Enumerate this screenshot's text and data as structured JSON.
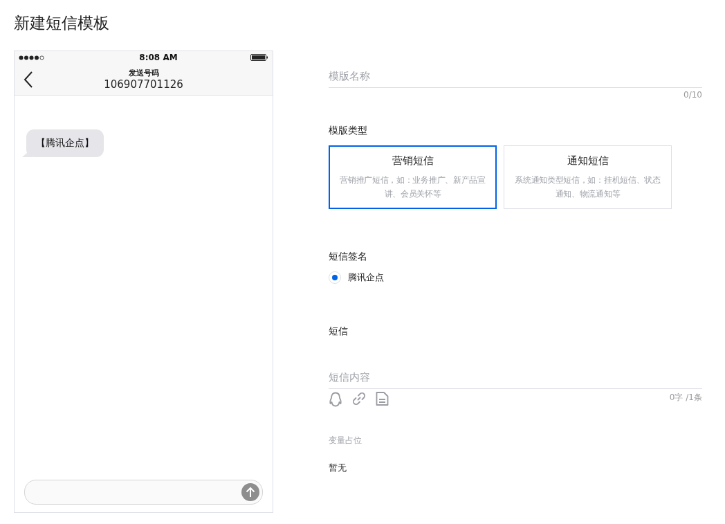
{
  "page_title": "新建短信模板",
  "phone": {
    "time": "8:08 AM",
    "header_label": "发送号码",
    "sender_number": "106907701126",
    "message": "【腾讯企点】"
  },
  "form": {
    "name_field": {
      "placeholder": "模版名称",
      "counter": "0/10"
    },
    "type_label": "模版类型",
    "types": [
      {
        "title": "营销短信",
        "description": "营销推广短信，如：业务推广、新产品宣讲、会员关怀等",
        "selected": true
      },
      {
        "title": "通知短信",
        "description": "系统通知类型短信，如：挂机短信、状态通知、物流通知等",
        "selected": false
      }
    ],
    "signature_label": "短信签名",
    "signatures": [
      {
        "label": "腾讯企点",
        "selected": true
      }
    ],
    "sms_label": "短信",
    "content_field": {
      "placeholder": "短信内容",
      "counter": "0字 /1条"
    },
    "variables_label": "变量占位",
    "variables_value": "暂无"
  }
}
